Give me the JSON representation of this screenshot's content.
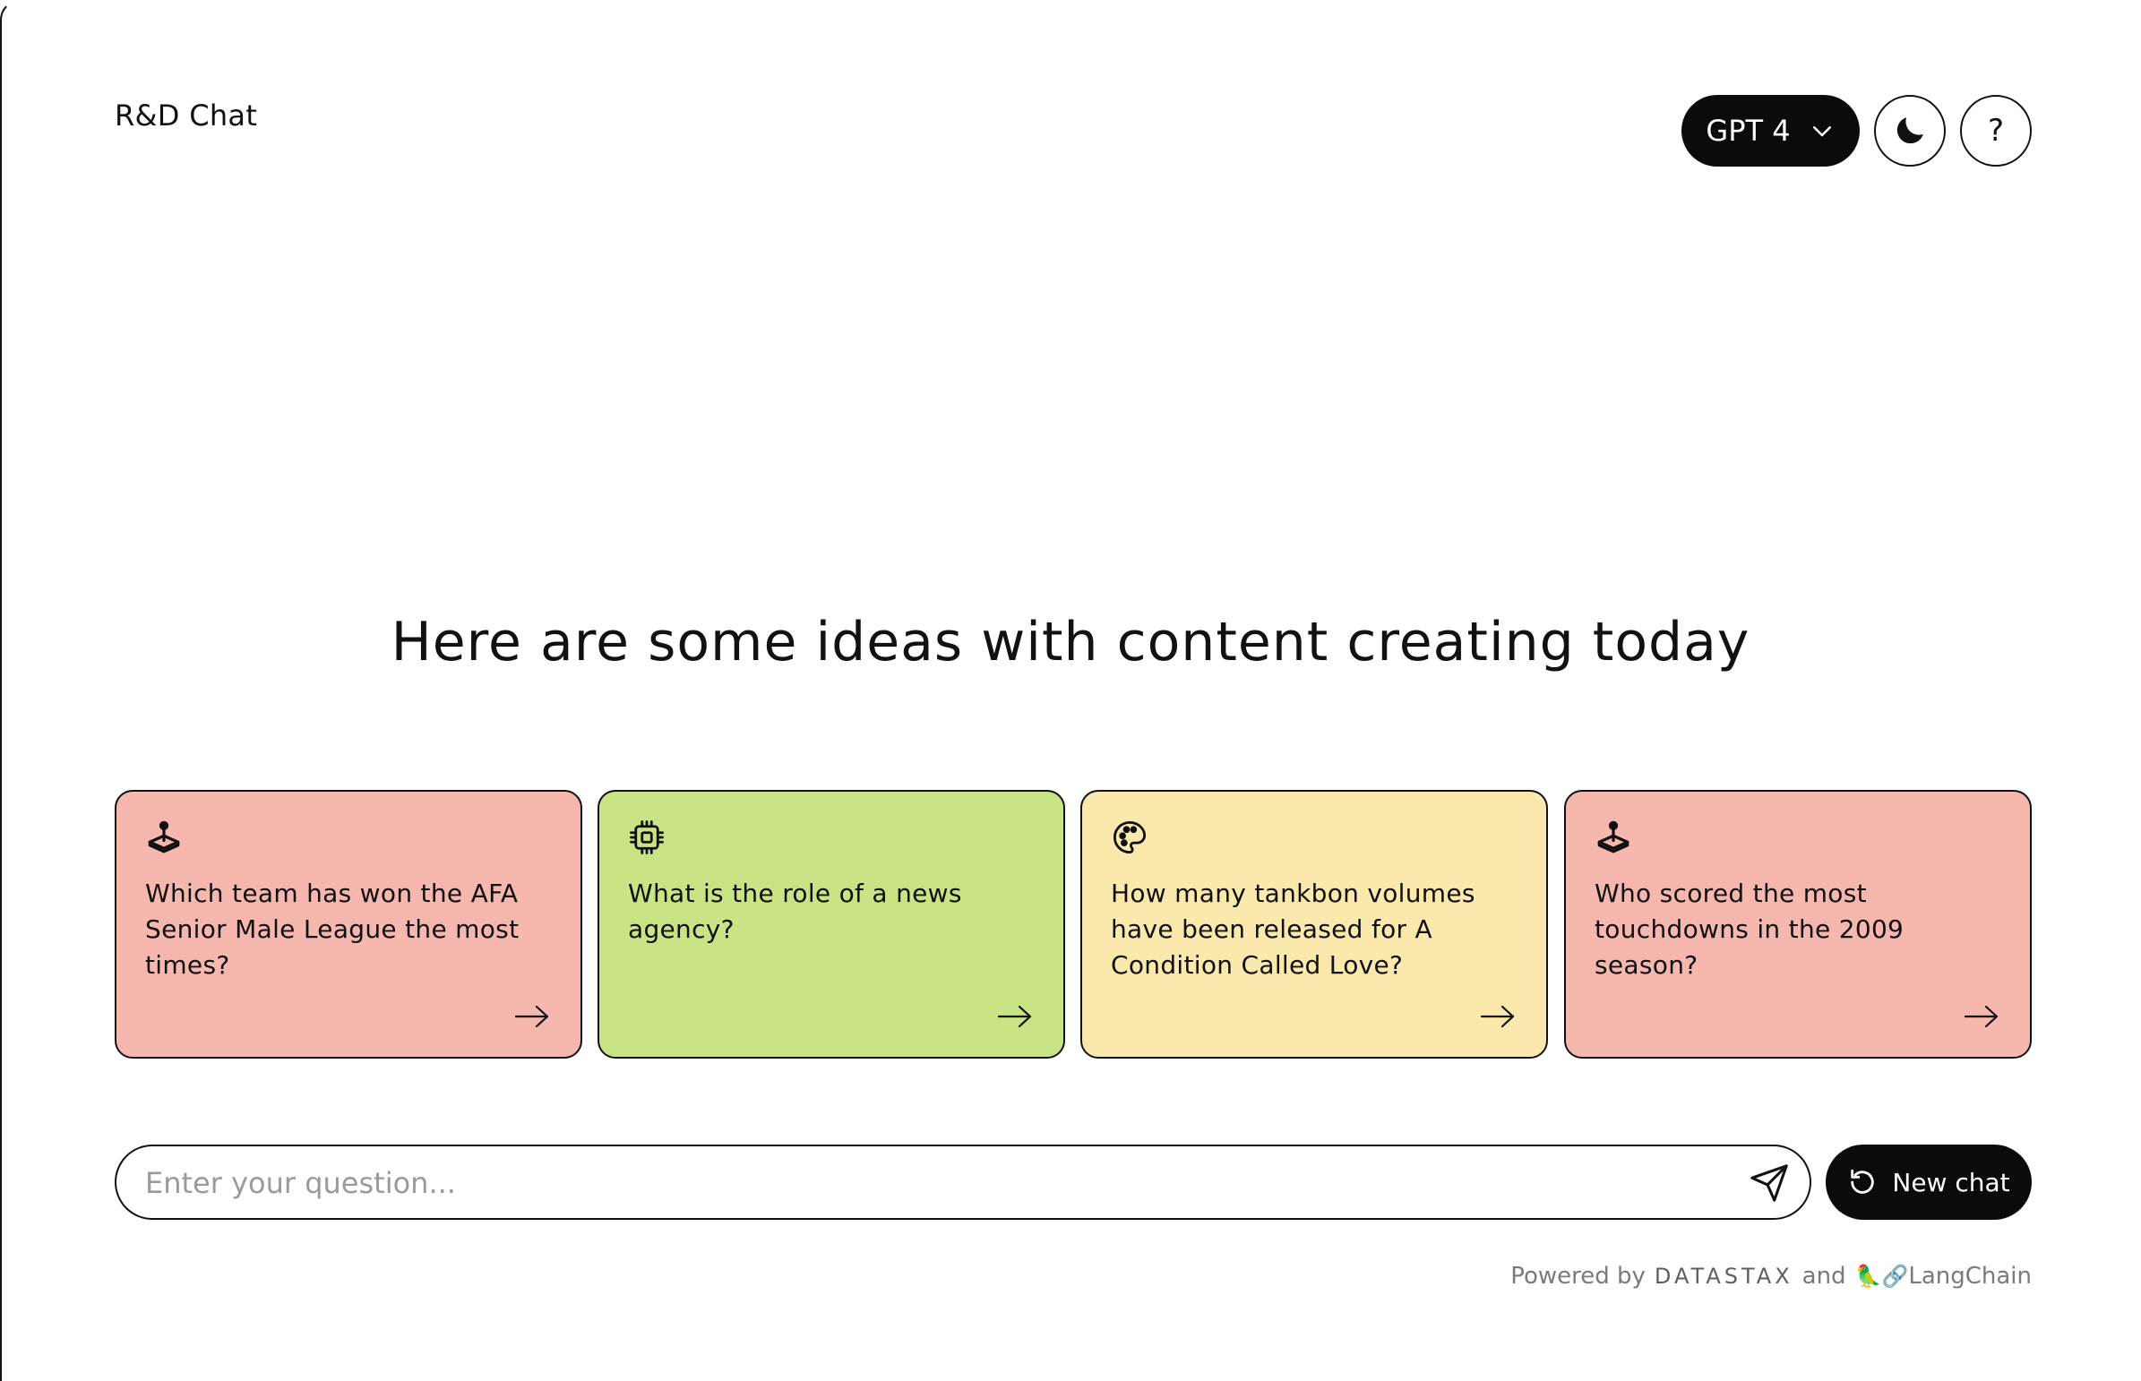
{
  "header": {
    "app_title": "R&D Chat",
    "model_label": "GPT 4",
    "help_label": "?"
  },
  "main": {
    "headline": "Here are some ideas with content creating today",
    "suggestions": [
      {
        "icon": "joystick-icon",
        "text": "Which team has won the AFA Senior Male League the most times?",
        "color": "#f5b7ae"
      },
      {
        "icon": "chip-icon",
        "text": "What is the role of a news agency?",
        "color": "#c9e484"
      },
      {
        "icon": "palette-icon",
        "text": "How many tankbon volumes have been released for A Condition Called Love?",
        "color": "#fbe8ac"
      },
      {
        "icon": "joystick-icon",
        "text": "Who scored the most touchdowns in the 2009 season?",
        "color": "#f5b7ae"
      }
    ]
  },
  "composer": {
    "placeholder": "Enter your question...",
    "value": "",
    "new_chat_label": "New chat"
  },
  "footer": {
    "powered_by": "Powered by",
    "datastax": "DATASTAX",
    "and": "and",
    "langchain_emoji": "🦜🔗",
    "langchain": "LangChain"
  },
  "colors": {
    "dark": "#0b0b0b",
    "card_red": "#f5b7ae",
    "card_green": "#c9e484",
    "card_yellow": "#fbe8ac"
  }
}
